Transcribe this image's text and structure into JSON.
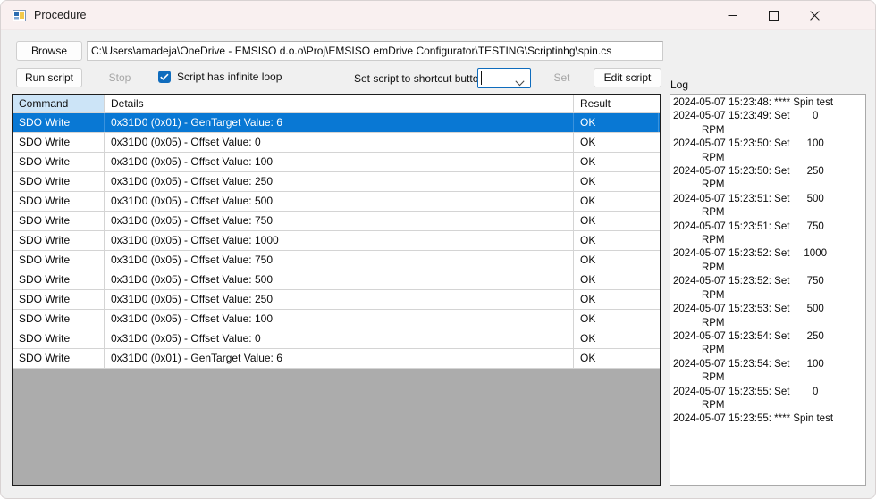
{
  "window": {
    "title": "Procedure",
    "icon": "winforms-designer-icon",
    "controls": {
      "minimize": "minimize-icon",
      "maximize": "maximize-icon",
      "close": "close-icon"
    }
  },
  "toolbar": {
    "browse_label": "Browse",
    "run_label": "Run script",
    "stop_label": "Stop",
    "stop_disabled": true,
    "script_path": "C:\\Users\\amadeja\\OneDrive - EMSISO d.o.o\\Proj\\EMSISO emDrive Configurator\\TESTING\\Scriptinhg\\spin.cs",
    "infinite_loop_label": "Script has infinite loop",
    "infinite_loop_checked": true,
    "shortcut_label": "Set script to shortcut button",
    "shortcut_value": "",
    "shortcut_options": [],
    "set_label": "Set",
    "set_disabled": true,
    "edit_label": "Edit script"
  },
  "grid": {
    "columns": [
      "Command",
      "Details",
      "Result"
    ],
    "selected_row_index": 0,
    "rows": [
      {
        "command": "SDO Write",
        "details": "0x31D0 (0x01) - GenTarget Value: 6",
        "result": "OK"
      },
      {
        "command": "SDO Write",
        "details": "0x31D0 (0x05) - Offset Value: 0",
        "result": "OK"
      },
      {
        "command": "SDO Write",
        "details": "0x31D0 (0x05) - Offset Value: 100",
        "result": "OK"
      },
      {
        "command": "SDO Write",
        "details": "0x31D0 (0x05) - Offset Value: 250",
        "result": "OK"
      },
      {
        "command": "SDO Write",
        "details": "0x31D0 (0x05) - Offset Value: 500",
        "result": "OK"
      },
      {
        "command": "SDO Write",
        "details": "0x31D0 (0x05) - Offset Value: 750",
        "result": "OK"
      },
      {
        "command": "SDO Write",
        "details": "0x31D0 (0x05) - Offset Value: 1000",
        "result": "OK"
      },
      {
        "command": "SDO Write",
        "details": "0x31D0 (0x05) - Offset Value: 750",
        "result": "OK"
      },
      {
        "command": "SDO Write",
        "details": "0x31D0 (0x05) - Offset Value: 500",
        "result": "OK"
      },
      {
        "command": "SDO Write",
        "details": "0x31D0 (0x05) - Offset Value: 250",
        "result": "OK"
      },
      {
        "command": "SDO Write",
        "details": "0x31D0 (0x05) - Offset Value: 100",
        "result": "OK"
      },
      {
        "command": "SDO Write",
        "details": "0x31D0 (0x05) - Offset Value: 0",
        "result": "OK"
      },
      {
        "command": "SDO Write",
        "details": "0x31D0 (0x01) - GenTarget Value: 6",
        "result": "OK"
      }
    ]
  },
  "log": {
    "label": "Log",
    "entries": [
      "2024-05-07 15:23:48: **** Spin test",
      "2024-05-07 15:23:49: Set        0\n          RPM",
      "2024-05-07 15:23:50: Set      100\n          RPM",
      "2024-05-07 15:23:50: Set      250\n          RPM",
      "2024-05-07 15:23:51: Set      500\n          RPM",
      "2024-05-07 15:23:51: Set      750\n          RPM",
      "2024-05-07 15:23:52: Set     1000\n          RPM",
      "2024-05-07 15:23:52: Set      750\n          RPM",
      "2024-05-07 15:23:53: Set      500\n          RPM",
      "2024-05-07 15:23:54: Set      250\n          RPM",
      "2024-05-07 15:23:54: Set      100\n          RPM",
      "2024-05-07 15:23:55: Set        0\n          RPM",
      "2024-05-07 15:23:55: **** Spin test"
    ]
  },
  "colors": {
    "selection_blue": "#0978D4",
    "header_selected_col": "#CCE4F7",
    "accent_checkbox": "#0F6CBD",
    "grid_empty_area": "#ACACAC",
    "window_bg": "#F0F0F0",
    "titlebar_bg": "#F9F0F0"
  }
}
